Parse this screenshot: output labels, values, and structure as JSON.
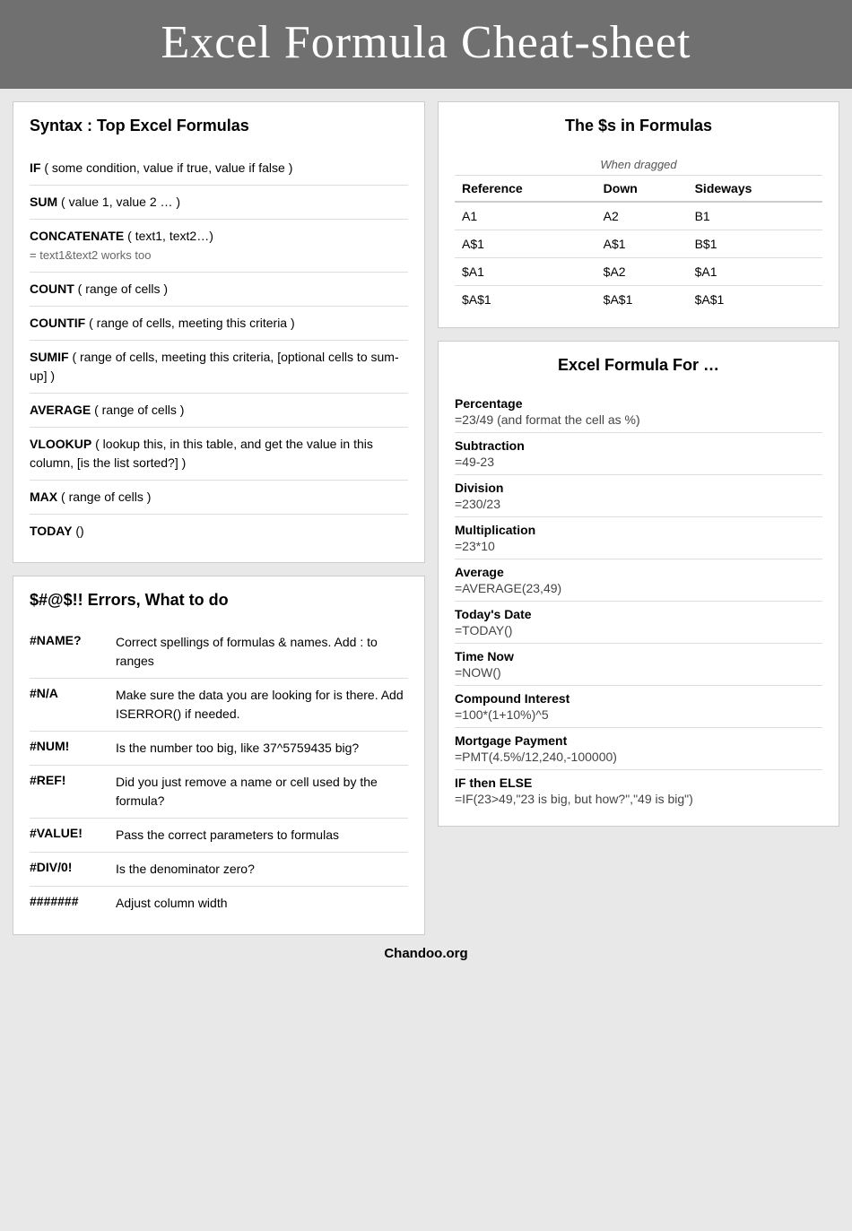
{
  "header": {
    "title": "Excel Formula Cheat-sheet"
  },
  "syntax": {
    "title": "Syntax : Top Excel Formulas",
    "items": [
      {
        "keyword": "IF",
        "text": " ( some condition, value if true, value if false )",
        "note": ""
      },
      {
        "keyword": "SUM",
        "text": " ( value 1, value 2 … )",
        "note": ""
      },
      {
        "keyword": "CONCATENATE",
        "text": " ( text1, text2…)",
        "note": "= text1&text2 works too"
      },
      {
        "keyword": "COUNT",
        "text": " ( range of cells )",
        "note": ""
      },
      {
        "keyword": "COUNTIF",
        "text": " ( range of cells, meeting this criteria )",
        "note": ""
      },
      {
        "keyword": "SUMIF",
        "text": " ( range of cells, meeting this criteria, [optional cells to sum-up] )",
        "note": ""
      },
      {
        "keyword": "AVERAGE",
        "text": " ( range of cells )",
        "note": ""
      },
      {
        "keyword": "VLOOKUP",
        "text": " ( lookup this, in this table, and get the value in this column, [is the list sorted?] )",
        "note": ""
      },
      {
        "keyword": "MAX",
        "text": " ( range of cells )",
        "note": ""
      },
      {
        "keyword": "TODAY",
        "text": " ()",
        "note": ""
      }
    ]
  },
  "dollars": {
    "title": "The $s in Formulas",
    "when_dragged": "When dragged",
    "headers": [
      "Reference",
      "Down",
      "Sideways"
    ],
    "rows": [
      [
        "A1",
        "A2",
        "B1"
      ],
      [
        "A$1",
        "A$1",
        "B$1"
      ],
      [
        "$A1",
        "$A2",
        "$A1"
      ],
      [
        "$A$1",
        "$A$1",
        "$A$1"
      ]
    ]
  },
  "errors": {
    "title": "$#@$!! Errors, What to do",
    "items": [
      {
        "code": "#NAME?",
        "desc": "Correct spellings of formulas & names. Add : to ranges"
      },
      {
        "code": "#N/A",
        "desc": "Make sure the data you are looking for is there. Add ISERROR() if needed."
      },
      {
        "code": "#NUM!",
        "desc": "Is the number too big, like 37^5759435 big?"
      },
      {
        "code": "#REF!",
        "desc": "Did you just remove a name or cell used by the formula?"
      },
      {
        "code": "#VALUE!",
        "desc": "Pass the correct parameters to formulas"
      },
      {
        "code": "#DIV/0!",
        "desc": "Is the denominator zero?"
      },
      {
        "code": "#######",
        "desc": "Adjust column width"
      }
    ]
  },
  "formulas_for": {
    "title": "Excel Formula For …",
    "items": [
      {
        "label": "Percentage",
        "value": "=23/49 (and format the cell as %)"
      },
      {
        "label": "Subtraction",
        "value": "=49-23"
      },
      {
        "label": "Division",
        "value": "=230/23"
      },
      {
        "label": "Multiplication",
        "value": "=23*10"
      },
      {
        "label": "Average",
        "value": "=AVERAGE(23,49)"
      },
      {
        "label": "Today's Date",
        "value": "=TODAY()"
      },
      {
        "label": "Time Now",
        "value": "=NOW()"
      },
      {
        "label": "Compound Interest",
        "value": "=100*(1+10%)^5"
      },
      {
        "label": "Mortgage Payment",
        "value": "=PMT(4.5%/12,240,-100000)"
      },
      {
        "label": "IF then ELSE",
        "value": "=IF(23>49,\"23 is big, but how?\",\"49 is big\")"
      }
    ]
  },
  "footer": {
    "text": "Chandoo.org"
  }
}
